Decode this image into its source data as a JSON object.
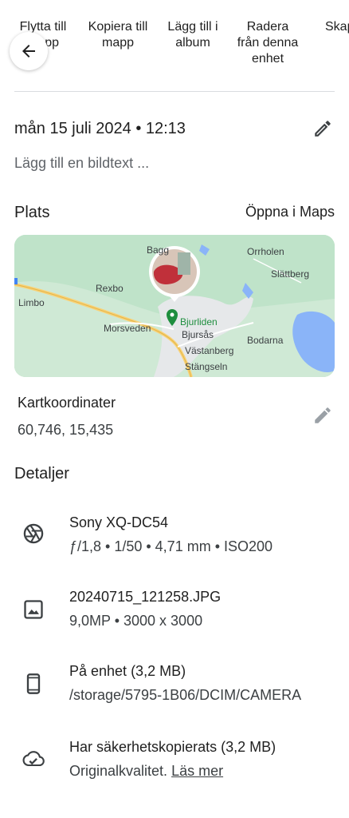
{
  "actions": [
    {
      "label_line1": "Flytta till",
      "label_line2": "mapp"
    },
    {
      "label_line1": "Kopiera till",
      "label_line2": "mapp"
    },
    {
      "label_line1": "Lägg till i",
      "label_line2": "album"
    },
    {
      "label_line1": "Radera",
      "label_line2": "från denna",
      "label_line3": "enhet"
    },
    {
      "label_line1": "Skap"
    }
  ],
  "back_icon": "arrow-back-icon",
  "date": {
    "text": "mån 15 juli 2024 • 12:13",
    "edit_icon": "pencil-icon"
  },
  "caption_placeholder": "Lägg till en bildtext ...",
  "location": {
    "title": "Plats",
    "open_maps": "Öppna i Maps",
    "map_labels": {
      "bagg": "Bagg",
      "orrholen": "Orrholen",
      "slattberg": "Slättberg",
      "rexbo": "Rexbo",
      "limbo": "Limbo",
      "bjurliden": "Bjurliden",
      "bjursas": "Bjursås",
      "morsveden": "Morsveden",
      "bodarna": "Bodarna",
      "vastanberg": "Västanberg",
      "stangseln": "Stängseln"
    }
  },
  "coordinates": {
    "title": "Kartkoordinater",
    "value": "60,746, 15,435",
    "edit_icon": "pencil-icon"
  },
  "details": {
    "title": "Detaljer",
    "camera": {
      "icon": "aperture-icon",
      "title": "Sony XQ-DC54",
      "sub": "ƒ/1,8  •  1/50  •  4,71 mm  •  ISO200"
    },
    "file": {
      "icon": "image-icon",
      "title": "20240715_121258.JPG",
      "sub": "9,0MP  •  3000 x 3000"
    },
    "device": {
      "icon": "phone-icon",
      "title": "På enhet (3,2 MB)",
      "sub": "/storage/5795-1B06/DCIM/CAMERA"
    },
    "backup": {
      "icon": "cloud-done-icon",
      "title": "Har säkerhetskopierats (3,2 MB)",
      "sub": "Originalkvalitet.",
      "learn_more": "Läs mer"
    }
  },
  "colors": {
    "map_green": "#bfe3c9",
    "water": "#8ab4f8",
    "road": "#f9d276",
    "poi_green": "#1e8e3e"
  }
}
